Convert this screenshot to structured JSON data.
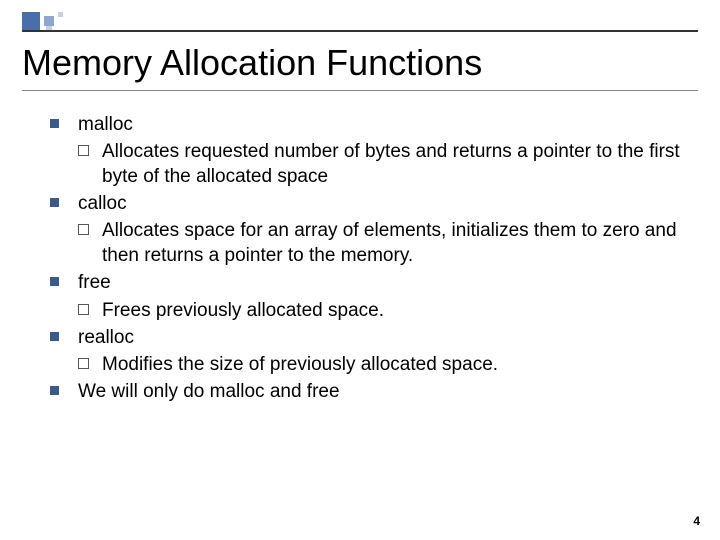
{
  "title": "Memory Allocation Functions",
  "items": [
    {
      "label": "malloc",
      "sub": "Allocates requested number of bytes and returns a pointer to the first byte of the allocated space"
    },
    {
      "label": "calloc",
      "sub": "Allocates space for an array of elements, initializes them to zero and then returns a pointer to the memory."
    },
    {
      "label": "free",
      "sub": "Frees previously allocated space."
    },
    {
      "label": "realloc",
      "sub": "Modifies the size of previously allocated space."
    },
    {
      "label": "We will only do malloc and free",
      "sub": null
    }
  ],
  "page_number": "4"
}
